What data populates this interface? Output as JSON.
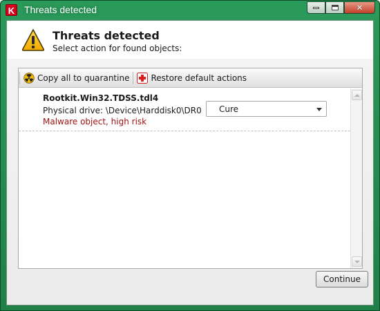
{
  "window": {
    "title": "Threats detected",
    "app_icon_letter": "K",
    "close_glyph": "✕",
    "accent_color": "#1f8048"
  },
  "header": {
    "title": "Threats detected",
    "subtitle": "Select action for found objects:",
    "icon": "warning-triangle-icon"
  },
  "toolbar": {
    "copy_label": "Copy all to quarantine",
    "copy_icon": "radiation-icon",
    "restore_label": "Restore default actions",
    "restore_icon": "medical-cross-icon"
  },
  "threats": [
    {
      "name": "Rootkit.Win32.TDSS.tdl4",
      "location": "Physical drive: \\Device\\Harddisk0\\DR0",
      "risk": "Malware object, high risk",
      "risk_color": "#a11212",
      "action": "Cure"
    }
  ],
  "footer": {
    "continue_label": "Continue"
  }
}
